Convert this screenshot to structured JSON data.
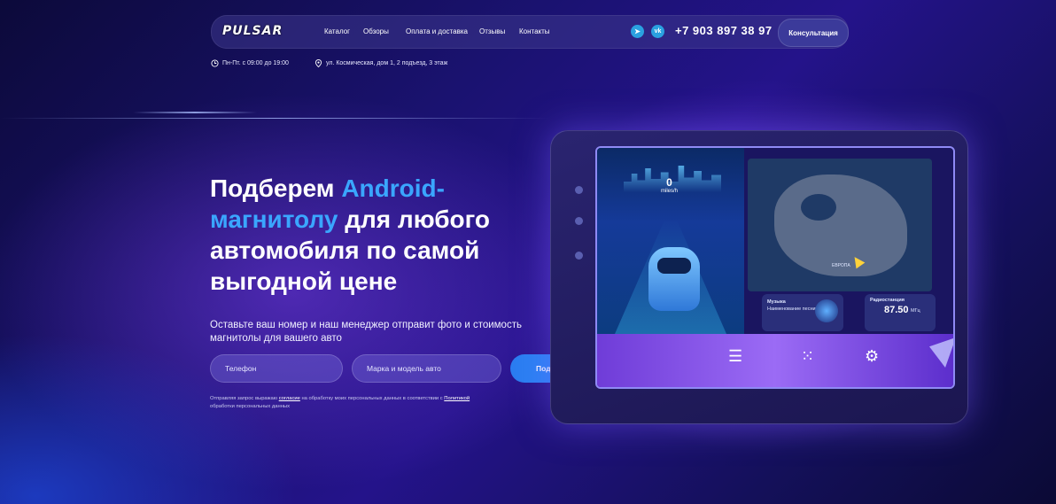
{
  "header": {
    "logo": "PULSAR",
    "nav": [
      "Каталог",
      "Обзоры",
      "Оплата и доставка",
      "Отзывы",
      "Контакты"
    ],
    "social": [
      {
        "icon": "telegram-icon",
        "glyph": "➤"
      },
      {
        "icon": "vk-icon",
        "glyph": "vk"
      }
    ],
    "phone": "+7 903 897 38 97",
    "consult_label": "Консультация"
  },
  "info": {
    "hours": "Пн-Пт. с 09:00 до 19:00",
    "address": "ул. Космическая, дом 1, 2 подъезд, 3 этаж"
  },
  "hero": {
    "title_part1": "Подберем ",
    "title_highlight1": "Android-",
    "title_highlight2": "магнитолу",
    "title_part2": " для любого автомобиля по самой выгодной цене",
    "subtitle": "Оставьте ваш номер и наш менеджер отправит фото и стоимость магнитолы для вашего авто"
  },
  "form": {
    "phone_placeholder": "Телефон",
    "car_placeholder": "Марка и модель авто",
    "submit_label": "Подобрать варианты"
  },
  "consent": {
    "text_before": "Отправляя запрос выражаю ",
    "consent_link": "согласие",
    "text_middle": " на обработку моих персональных данных в соответствии с ",
    "policy_link": "Политикой",
    "text_after": " обработки персональных данных"
  },
  "device": {
    "speed_value": "0",
    "speed_unit": "miles/h",
    "music_title": "Музыка",
    "music_song": "Наименование песни",
    "radio_title": "Радиостанция",
    "radio_freq": "87.50",
    "radio_unit": "МГц",
    "map_label": "ЕВРОПА"
  },
  "colors": {
    "accent": "#3aa6ff",
    "cta": "#1e8bff",
    "background": "#1a1270"
  }
}
